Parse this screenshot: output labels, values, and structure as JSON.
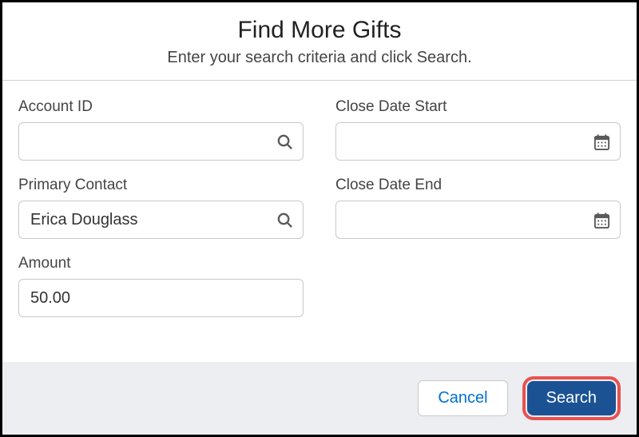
{
  "header": {
    "title": "Find More Gifts",
    "subtitle": "Enter your search criteria and click Search."
  },
  "fields": {
    "account_id": {
      "label": "Account ID",
      "value": ""
    },
    "primary_contact": {
      "label": "Primary Contact",
      "value": "Erica Douglass"
    },
    "amount": {
      "label": "Amount",
      "value": "50.00"
    },
    "close_date_start": {
      "label": "Close Date Start",
      "value": ""
    },
    "close_date_end": {
      "label": "Close Date End",
      "value": ""
    }
  },
  "footer": {
    "cancel_label": "Cancel",
    "search_label": "Search"
  }
}
